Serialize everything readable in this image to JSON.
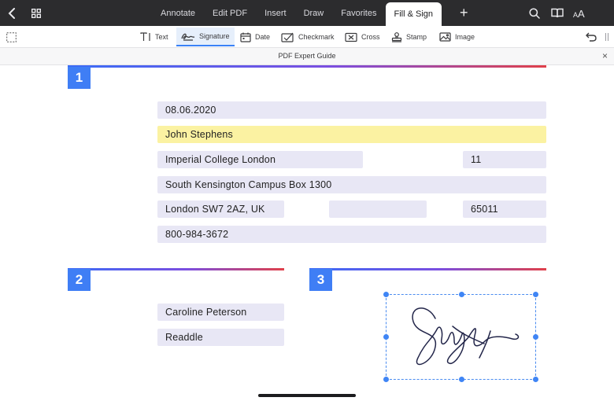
{
  "topbar": {
    "tabs": [
      {
        "label": "Annotate",
        "active": false
      },
      {
        "label": "Edit PDF",
        "active": false
      },
      {
        "label": "Insert",
        "active": false
      },
      {
        "label": "Draw",
        "active": false
      },
      {
        "label": "Favorites",
        "active": false
      },
      {
        "label": "Fill & Sign",
        "active": true
      }
    ],
    "add_label": "+",
    "icons": [
      "back-chevron-icon",
      "grid-icon",
      "search-icon",
      "book-icon",
      "text-size-icon"
    ]
  },
  "toolbar": {
    "tools": [
      {
        "label": "Text",
        "icon": "text-icon"
      },
      {
        "label": "Signature",
        "icon": "signature-icon",
        "active": true
      },
      {
        "label": "Date",
        "icon": "calendar-icon"
      },
      {
        "label": "Checkmark",
        "icon": "checkmark-icon"
      },
      {
        "label": "Cross",
        "icon": "cross-icon"
      },
      {
        "label": "Stamp",
        "icon": "stamp-icon"
      },
      {
        "label": "Image",
        "icon": "image-icon"
      }
    ]
  },
  "document": {
    "title": "PDF Expert Guide",
    "close_label": "×"
  },
  "sections": [
    {
      "number": "1"
    },
    {
      "number": "2"
    },
    {
      "number": "3"
    }
  ],
  "form": {
    "date": "08.06.2020",
    "name": "John Stephens",
    "institution": "Imperial College London",
    "institution_no": "11",
    "address": "South Kensington Campus Box 1300",
    "city": "London SW7 2AZ, UK",
    "blank": "",
    "postcode": "65011",
    "phone": "800-984-3672",
    "contact_name": "Caroline Peterson",
    "company": "Readdle"
  },
  "colors": {
    "accent": "#3f7ef5",
    "highlight": "#fbf2a2",
    "field": "#e8e7f5",
    "topbar": "#2c2c2e"
  }
}
